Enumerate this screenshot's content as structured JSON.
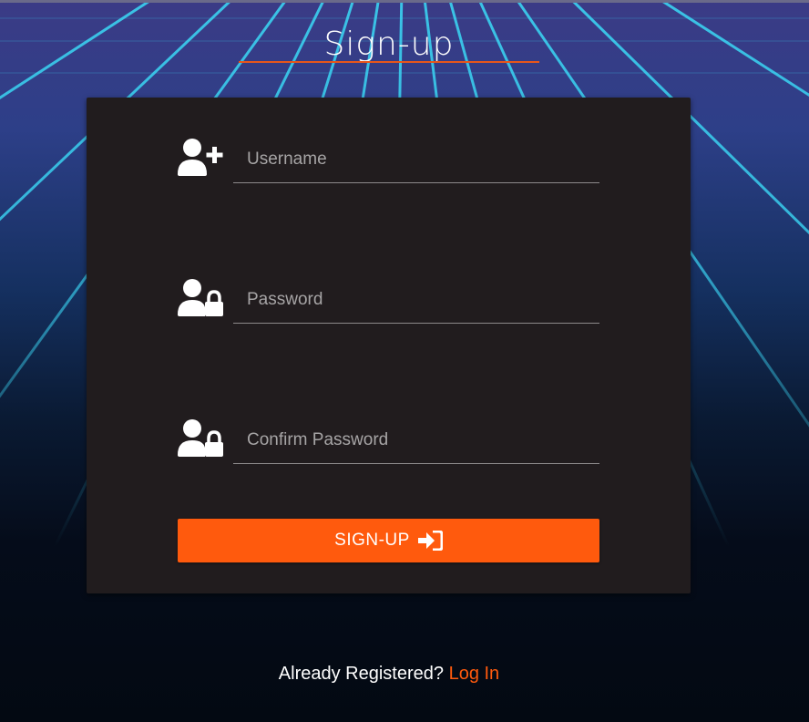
{
  "title": "Sign-up",
  "form": {
    "username": {
      "placeholder": "Username",
      "value": "",
      "icon": "user-plus-icon"
    },
    "password": {
      "placeholder": "Password",
      "value": "",
      "icon": "user-lock-icon"
    },
    "confirm_password": {
      "placeholder": "Confirm Password",
      "value": "",
      "icon": "user-lock-icon"
    },
    "submit_label": "SIGN-UP",
    "submit_icon": "sign-in-icon"
  },
  "footer": {
    "prompt": "Already Registered?",
    "link": "Log In"
  },
  "colors": {
    "accent": "#ff5a0d",
    "card_bg": "#211c1e",
    "grid_line": "#35d3f0"
  }
}
